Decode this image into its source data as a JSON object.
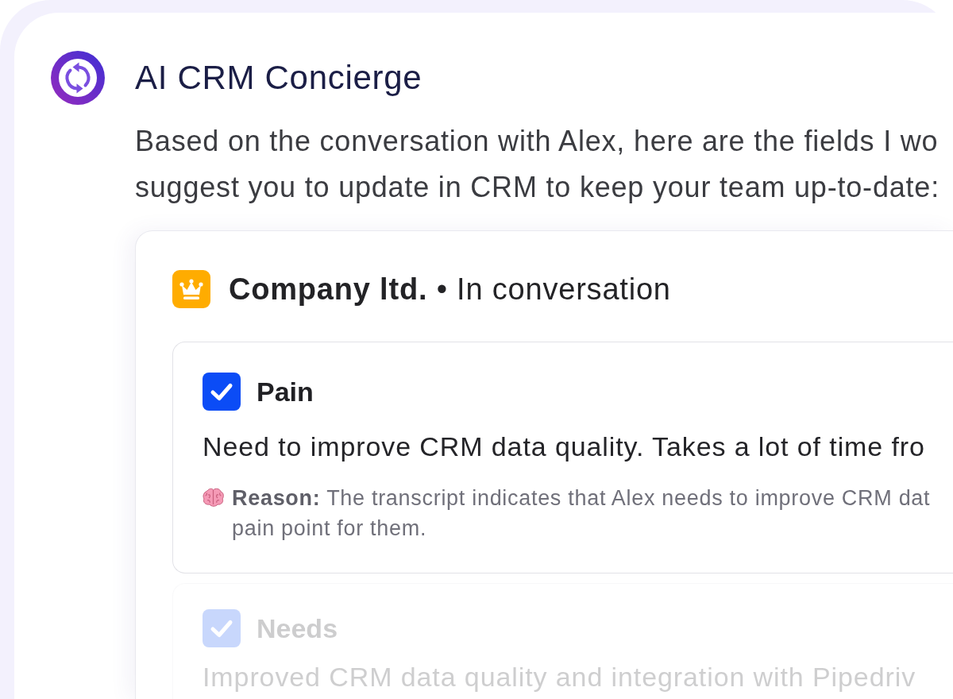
{
  "assistant": {
    "name": "AI CRM Concierge"
  },
  "message": {
    "lines": [
      "Based on the conversation with Alex, here are the fields I wo",
      "suggest you to update in CRM to keep your team up-to-date:"
    ]
  },
  "deal": {
    "title": "**Company ltd.** • In conversation",
    "fields": [
      {
        "label": "Pain",
        "checked": true,
        "disabled": false,
        "value": "Need to improve CRM data quality. Takes a lot of time fro",
        "reason": [
          "**Reason:** The transcript indicates that Alex needs to improve CRM dat",
          "pain point for them."
        ]
      },
      {
        "label": "Needs",
        "checked": true,
        "disabled": true,
        "value": "Improved CRM data quality and integration with Pipedriv"
      }
    ]
  }
}
